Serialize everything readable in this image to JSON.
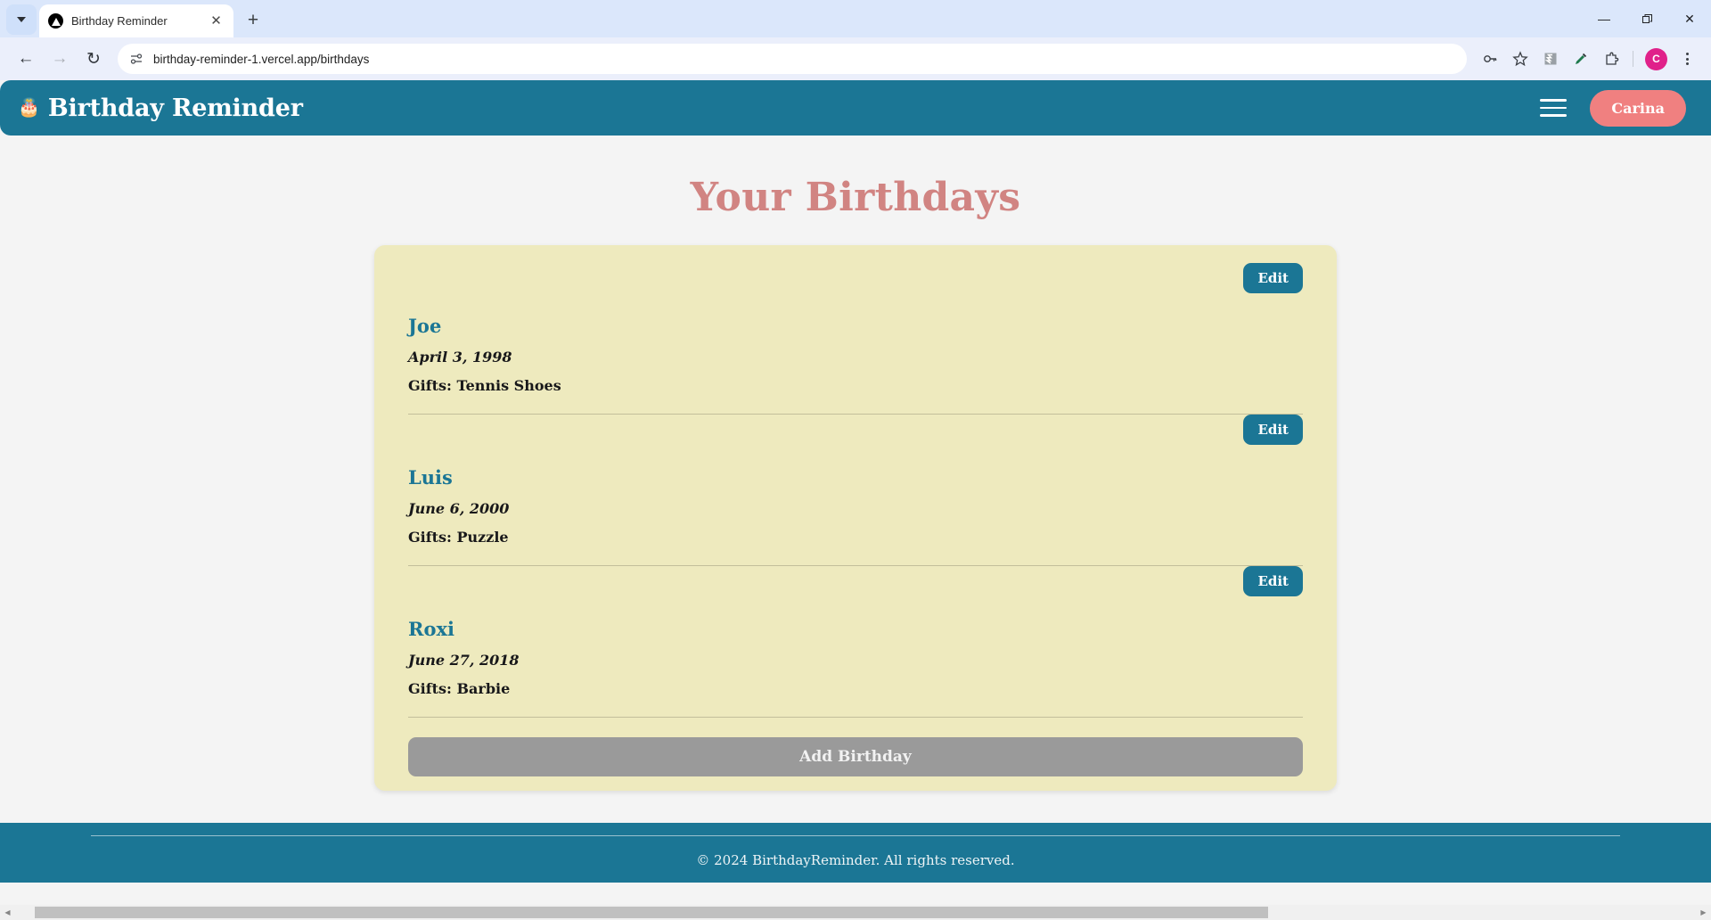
{
  "browser": {
    "tab": {
      "title": "Birthday Reminder",
      "favicon": "vercel-triangle-icon",
      "close_label": "✕"
    },
    "new_tab_label": "+",
    "tab_search_icon": "chevron-down-icon",
    "window_controls": {
      "minimize": "—",
      "maximize": "❐",
      "close": "✕"
    },
    "nav": {
      "back": "←",
      "forward": "→",
      "reload": "↻"
    },
    "omnibox": {
      "url": "birthday-reminder-1.vercel.app/birthdays",
      "site_info_icon": "site-settings-icon"
    },
    "toolbar_icons": [
      "password-key-icon",
      "bookmark-star-icon",
      "extension-zigzag-icon",
      "eyedropper-icon",
      "puzzle-extensions-icon"
    ],
    "profile_initial": "C",
    "menu_icon": "three-dot-menu-icon"
  },
  "app": {
    "header": {
      "brand_icon": "🎂",
      "brand": "Birthday Reminder",
      "menu_icon": "hamburger-menu-icon",
      "user": "Carina"
    },
    "page_title": "Your Birthdays",
    "edit_label": "Edit",
    "birthdays": [
      {
        "name": "Joe",
        "date": "April 3, 1998",
        "gifts": "Gifts: Tennis Shoes"
      },
      {
        "name": "Luis",
        "date": "June 6, 2000",
        "gifts": "Gifts: Puzzle"
      },
      {
        "name": "Roxi",
        "date": "June 27, 2018",
        "gifts": "Gifts: Barbie"
      }
    ],
    "add_button": "Add Birthday",
    "footer": "© 2024 BirthdayReminder. All rights reserved."
  },
  "colors": {
    "teal": "#1b7695",
    "card_yellow": "#eeeabe",
    "title_rose": "#d18482",
    "user_pill": "#f08080",
    "add_button_gray": "#9a9a9a"
  }
}
